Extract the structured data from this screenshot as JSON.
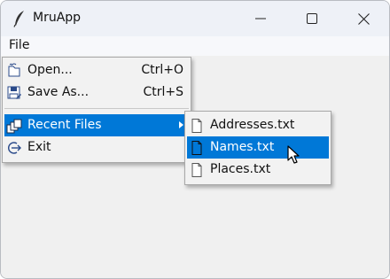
{
  "window": {
    "title": "MruApp",
    "controls": [
      "minimize",
      "maximize",
      "close"
    ]
  },
  "menubar": {
    "items": [
      {
        "label": "File"
      }
    ]
  },
  "file_menu": {
    "items": [
      {
        "label": "Open...",
        "shortcut": "Ctrl+O",
        "icon": "open-folder-icon"
      },
      {
        "label": "Save As...",
        "shortcut": "Ctrl+S",
        "icon": "save-as-icon"
      },
      {
        "label": "Recent Files",
        "icon": "recent-files-icon",
        "submenu": true,
        "highlighted": true
      },
      {
        "label": "Exit",
        "icon": "exit-icon"
      }
    ]
  },
  "recent_menu": {
    "items": [
      {
        "label": "Addresses.txt",
        "icon": "document-icon"
      },
      {
        "label": "Names.txt",
        "icon": "document-icon",
        "highlighted": true
      },
      {
        "label": "Places.txt",
        "icon": "document-icon"
      }
    ]
  },
  "colors": {
    "highlight": "#0078d7",
    "titlebar": "#eef1f7",
    "menu_bg": "#f2f2f2"
  }
}
